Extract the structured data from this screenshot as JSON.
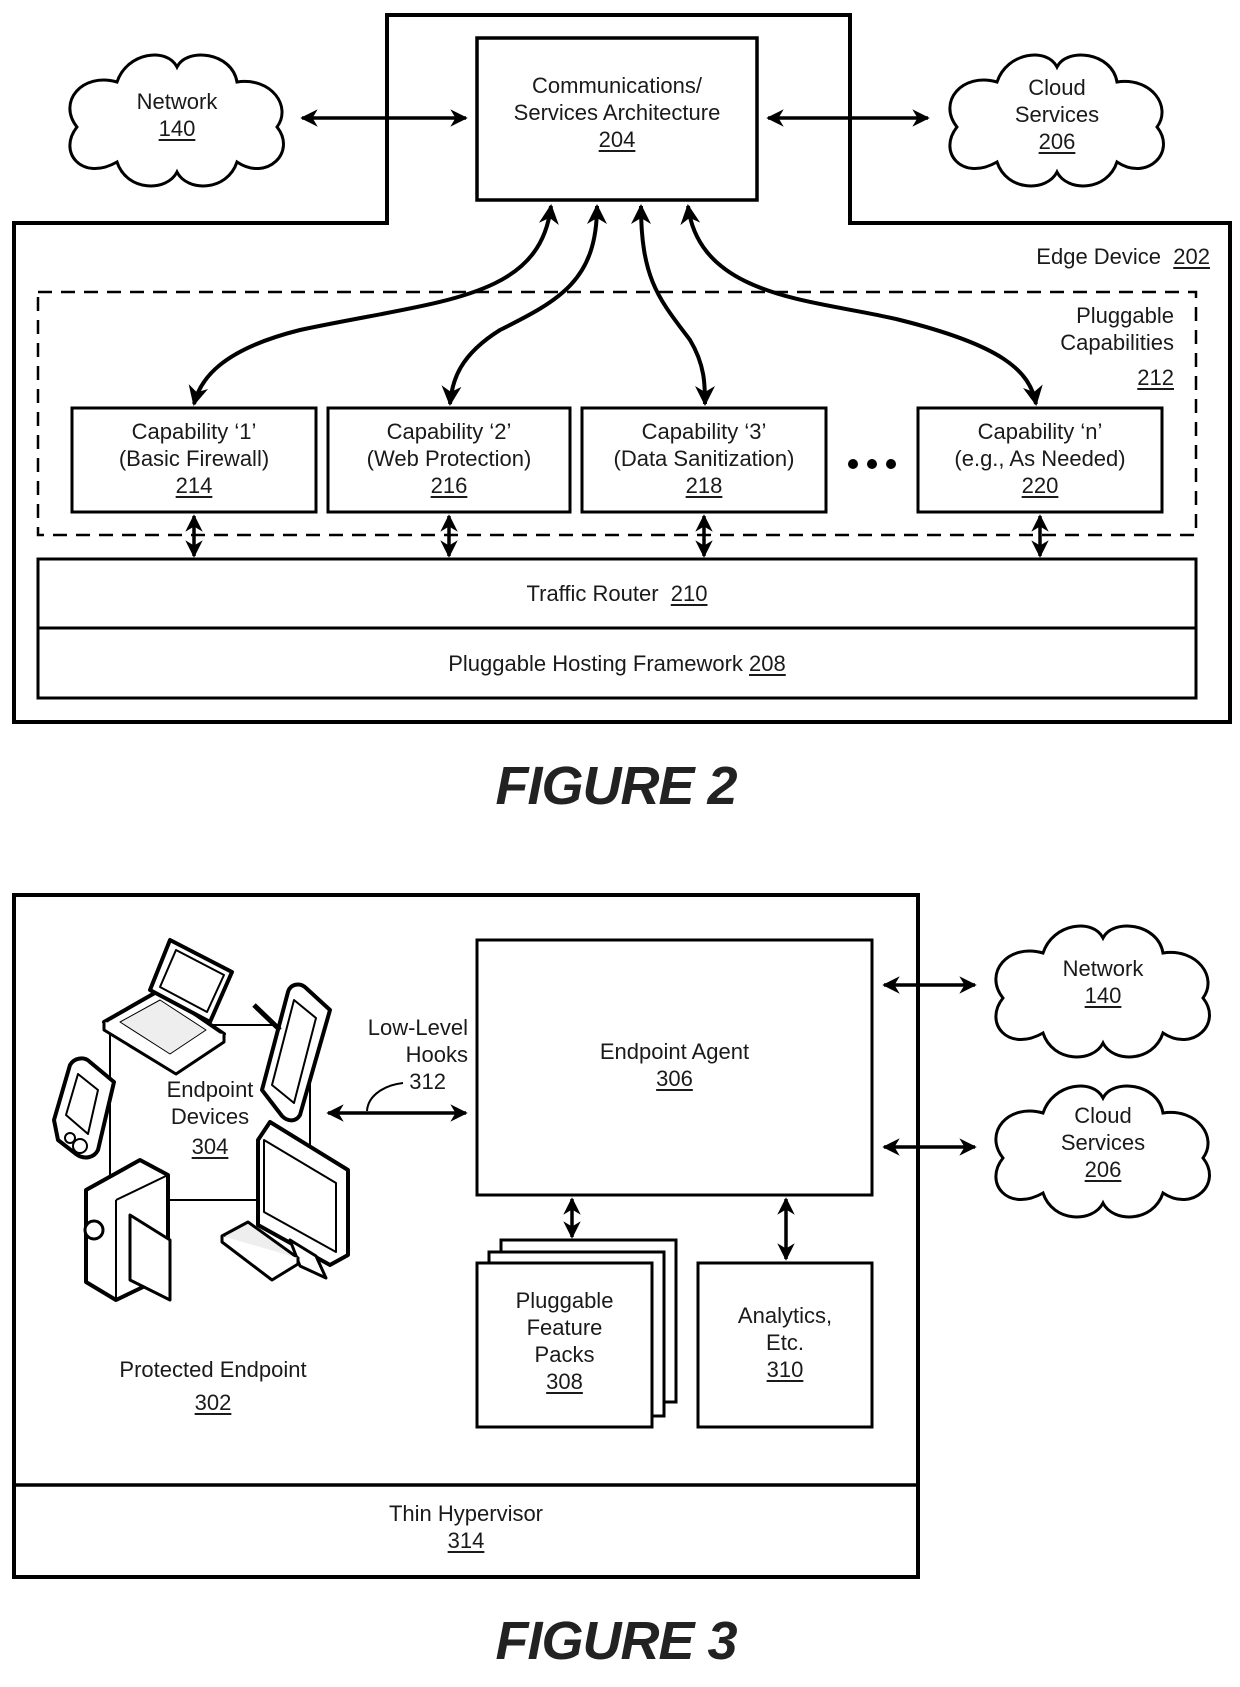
{
  "figure2": {
    "caption": "FIGURE 2",
    "network": {
      "line1": "Network",
      "ref": "140"
    },
    "cloud_services": {
      "line1": "Cloud",
      "line2": "Services",
      "ref": "206"
    },
    "comm_arch": {
      "line1": "Communications/",
      "line2": "Services Architecture",
      "ref": "204"
    },
    "edge_device": {
      "label": "Edge Device",
      "ref": "202"
    },
    "pluggable_capabilities": {
      "line1": "Pluggable",
      "line2": "Capabilities",
      "ref": "212"
    },
    "capabilities": [
      {
        "line1": "Capability ‘1’",
        "line2": "(Basic Firewall)",
        "ref": "214"
      },
      {
        "line1": "Capability ‘2’",
        "line2": "(Web Protection)",
        "ref": "216"
      },
      {
        "line1": "Capability ‘3’",
        "line2": "(Data Sanitization)",
        "ref": "218"
      },
      {
        "line1": "Capability ‘n’",
        "line2": "(e.g., As Needed)",
        "ref": "220"
      }
    ],
    "ellipsis": "•••",
    "traffic_router": {
      "label": "Traffic Router",
      "ref": "210"
    },
    "hosting_framework": {
      "label": "Pluggable Hosting Framework",
      "ref": "208"
    }
  },
  "figure3": {
    "caption": "FIGURE 3",
    "endpoint_devices": {
      "line1": "Endpoint",
      "line2": "Devices",
      "ref": "304"
    },
    "hooks": {
      "line1": "Low-Level",
      "line2": "Hooks",
      "ref": "312"
    },
    "endpoint_agent": {
      "line1": "Endpoint Agent",
      "ref": "306"
    },
    "feature_packs": {
      "line1": "Pluggable",
      "line2": "Feature",
      "line3": "Packs",
      "ref": "308"
    },
    "analytics": {
      "line1": "Analytics,",
      "line2": "Etc.",
      "ref": "310"
    },
    "protected_endpoint": {
      "line1": "Protected Endpoint",
      "ref": "302"
    },
    "thin_hypervisor": {
      "line1": "Thin Hypervisor",
      "ref": "314"
    },
    "network": {
      "line1": "Network",
      "ref": "140"
    },
    "cloud_services": {
      "line1": "Cloud",
      "line2": "Services",
      "ref": "206"
    }
  }
}
